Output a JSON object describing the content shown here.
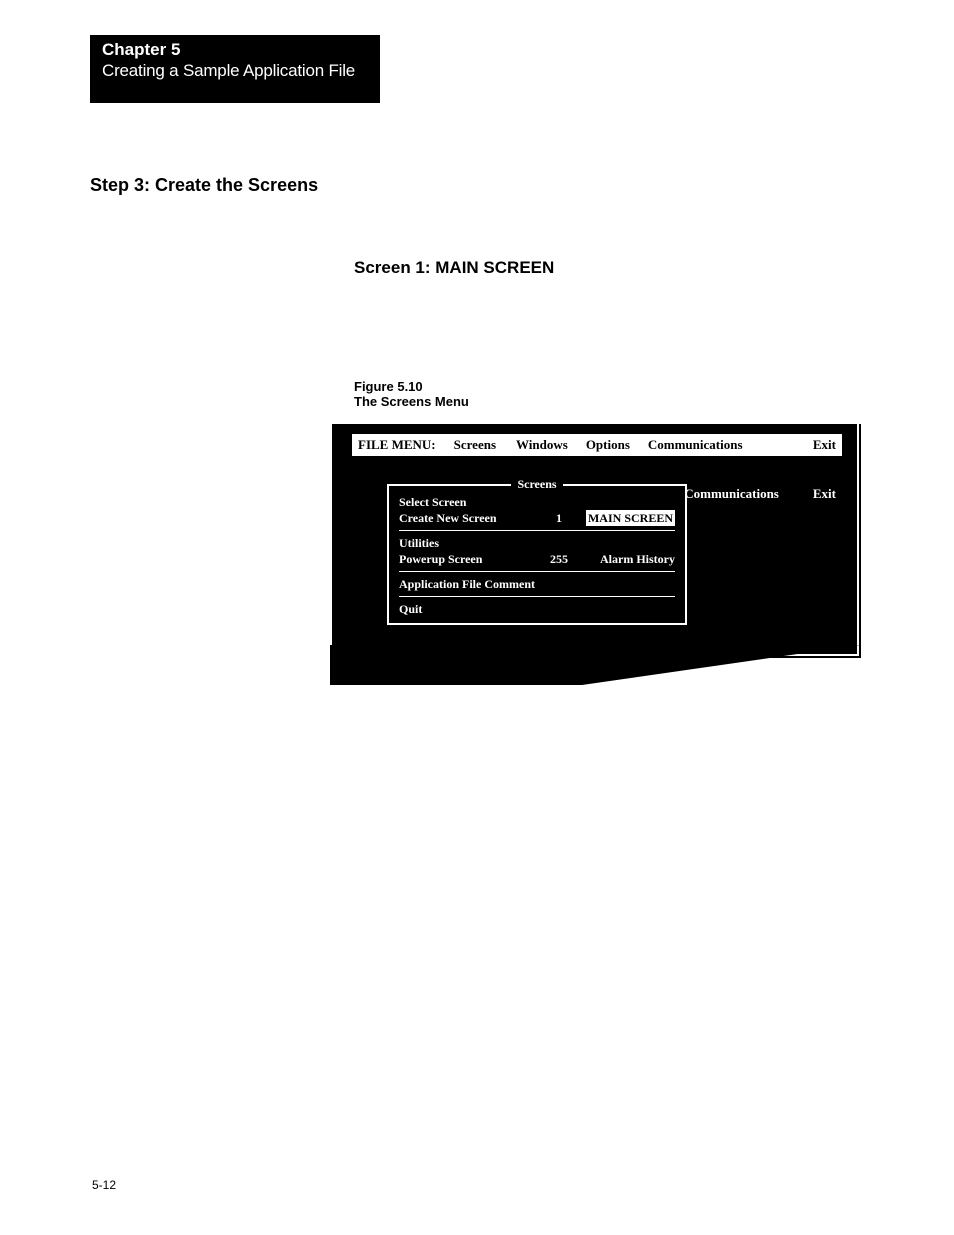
{
  "chapter": {
    "title": "Chapter 5",
    "subtitle": "Creating a Sample Application File"
  },
  "headings": {
    "step": "Step 3: Create the Screens",
    "screen": "Screen 1: MAIN SCREEN"
  },
  "figure": {
    "number": "Figure 5.10",
    "caption": "The Screens Menu"
  },
  "menubar": {
    "file_label": "FILE MENU:",
    "items": [
      "Screens",
      "Windows",
      "Options",
      "Communications",
      "Exit"
    ]
  },
  "secondary_bar": {
    "comm": "Communications",
    "exit": "Exit"
  },
  "dropdown": {
    "title": "Screens",
    "rows": {
      "select_screen": "Select Screen",
      "create_new_screen": {
        "label": "Create New Screen",
        "num": "1",
        "name": "MAIN SCREEN"
      },
      "utilities": "Utilities",
      "powerup_screen": {
        "label": "Powerup Screen",
        "num": "255",
        "name": "Alarm History"
      },
      "app_comment": "Application File Comment",
      "quit": "Quit"
    }
  },
  "page_number": "5-12"
}
